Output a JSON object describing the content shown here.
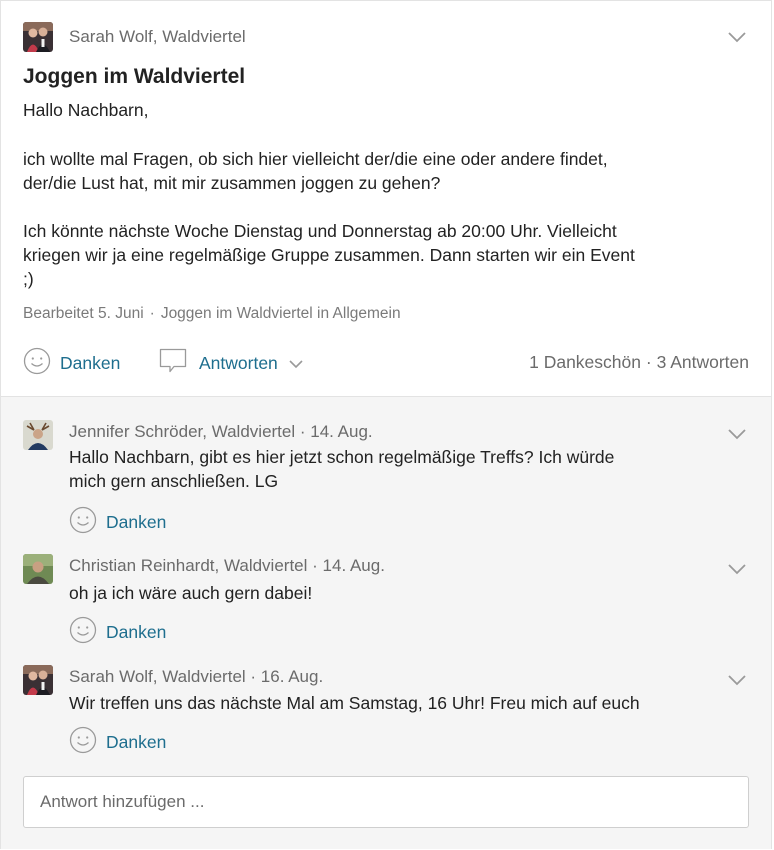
{
  "post": {
    "author": "Sarah Wolf, Waldviertel",
    "title": "Joggen im Waldviertel",
    "body_lines": [
      "Hallo Nachbarn,",
      "ich wollte mal Fragen,  ob sich hier vielleicht der/die eine oder andere findet,",
      "der/die Lust hat, mit mir zusammen joggen zu gehen?",
      "Ich könnte nächste Woche Dienstag und Donnerstag ab 20:00 Uhr. Vielleicht",
      "kriegen wir ja eine regelmäßige Gruppe zusammen. Dann starten wir ein Event",
      ";)"
    ],
    "meta_edited": "Bearbeitet 5. Juni",
    "meta_separator": "·",
    "meta_category": "Joggen im Waldviertel in Allgemein",
    "thank_label": "Danken",
    "reply_label": "Antworten",
    "stats_thanks": "1 Dankeschön",
    "stats_separator": "·",
    "stats_replies": "3 Antworten"
  },
  "comments": [
    {
      "author": "Jennifer Schröder, Waldviertel",
      "date": "14. Aug.",
      "text_lines": [
        "Hallo Nachbarn, gibt es hier jetzt schon regelmäßige Treffs? Ich würde",
        "mich gern anschließen. LG"
      ],
      "thank_label": "Danken"
    },
    {
      "author": "Christian Reinhardt, Waldviertel",
      "date": "14. Aug.",
      "text_lines": [
        "oh ja ich wäre auch gern dabei!"
      ],
      "thank_label": "Danken"
    },
    {
      "author": "Sarah Wolf, Waldviertel",
      "date": "16. Aug.",
      "text_lines": [
        "Wir treffen uns das nächste Mal am Samstag, 16 Uhr! Freu mich auf euch"
      ],
      "thank_label": "Danken"
    }
  ],
  "reply_input": {
    "placeholder": "Antwort hinzufügen ...",
    "value": ""
  },
  "colors": {
    "accent": "#1e6e8e",
    "muted_text": "#6b6b6b",
    "comment_bg": "#f5f5f5",
    "border": "#e3e3e3"
  },
  "icons": {
    "more": "chevron-down-icon",
    "thank": "smiley-icon",
    "reply": "speech-bubble-icon",
    "reply_expand": "chevron-down-icon"
  }
}
